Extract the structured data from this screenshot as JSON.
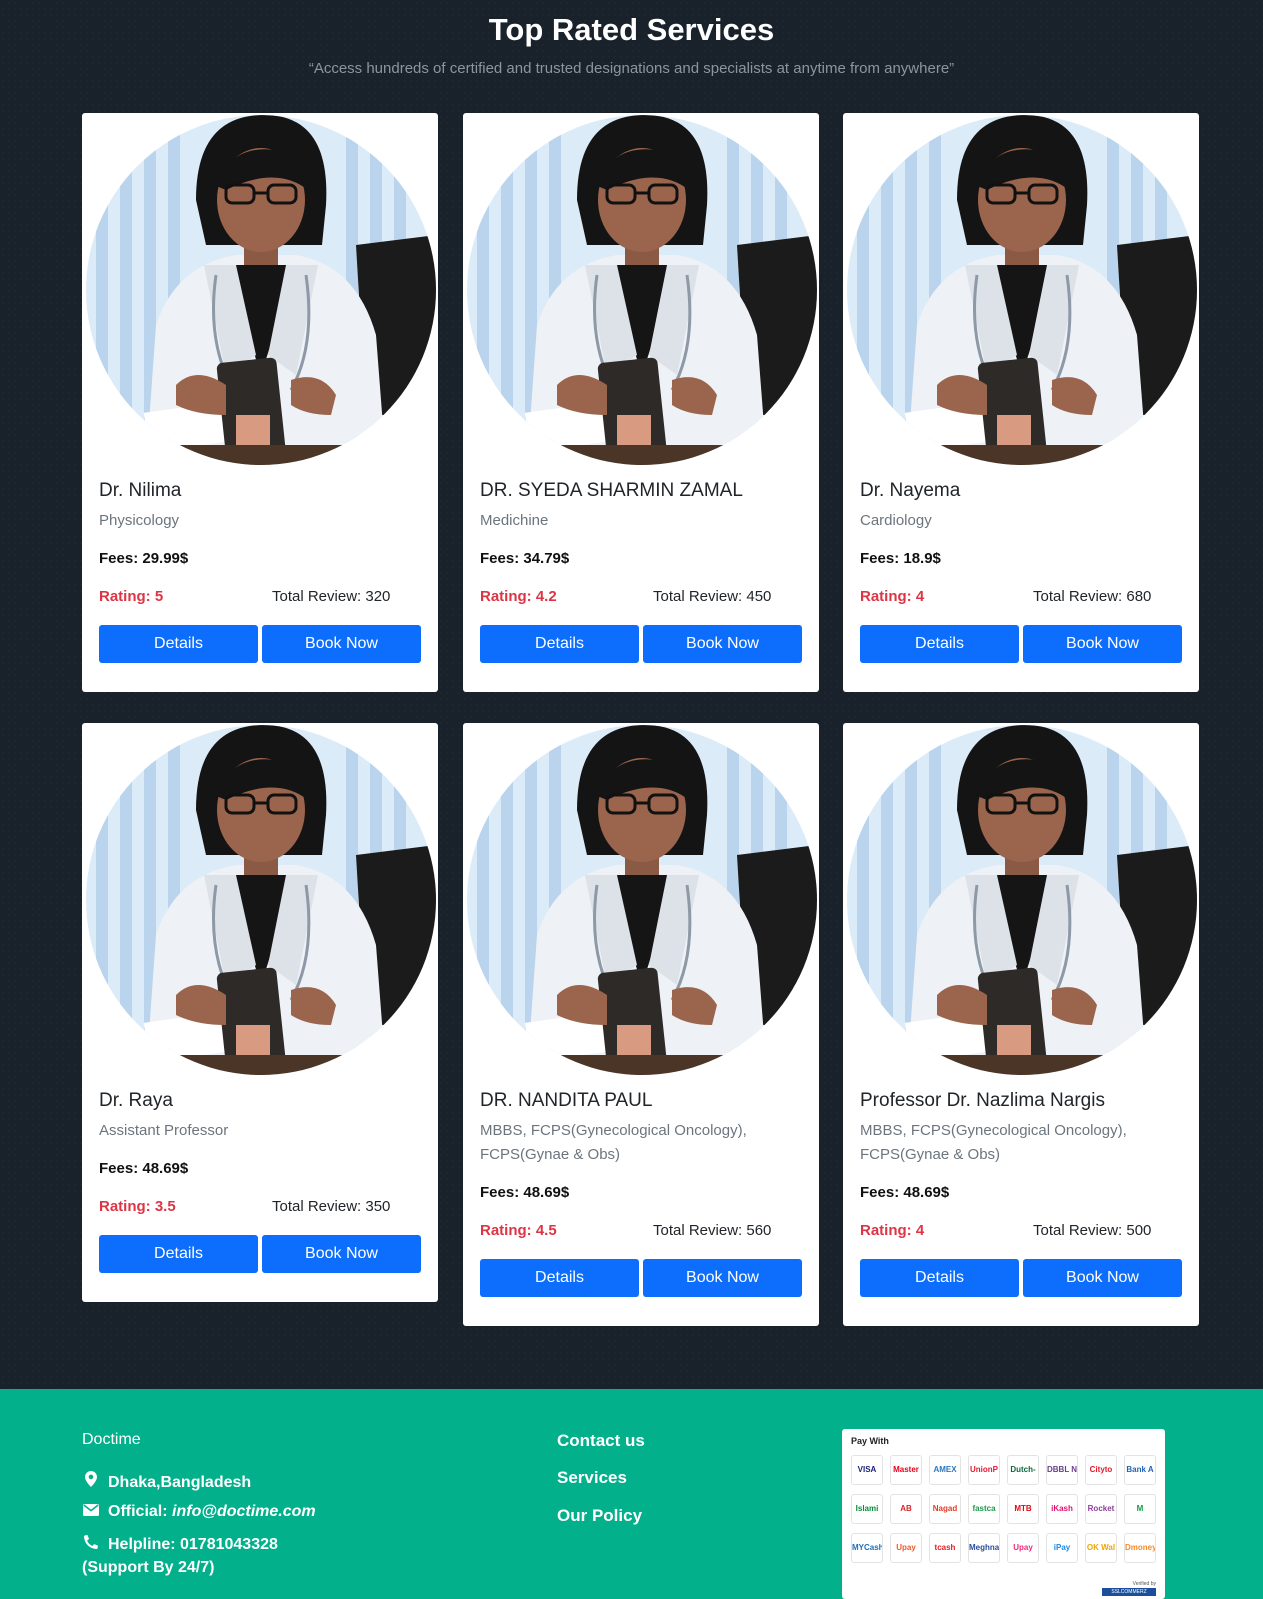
{
  "section": {
    "title": "Top Rated Services",
    "subtitle": "“Access hundreds of certified and trusted designations and specialists at anytime from anywhere”"
  },
  "doctors": [
    {
      "name": "Dr. Nilima",
      "specialty": "Physicology",
      "fees": "Fees: 29.99$",
      "rating": "Rating: 5",
      "reviews": "Total Review: 320",
      "details": "Details",
      "book": "Book Now"
    },
    {
      "name": "DR. SYEDA SHARMIN ZAMAL",
      "specialty": "Medichine",
      "fees": "Fees: 34.79$",
      "rating": "Rating: 4.2",
      "reviews": "Total Review: 450",
      "details": "Details",
      "book": "Book Now"
    },
    {
      "name": "Dr. Nayema",
      "specialty": "Cardiology",
      "fees": "Fees: 18.9$",
      "rating": "Rating: 4",
      "reviews": "Total Review: 680",
      "details": "Details",
      "book": "Book Now"
    },
    {
      "name": "Dr. Raya",
      "specialty": "Assistant Professor",
      "fees": "Fees: 48.69$",
      "rating": "Rating: 3.5",
      "reviews": "Total Review: 350",
      "details": "Details",
      "book": "Book Now"
    },
    {
      "name": "DR. NANDITA PAUL",
      "specialty": "MBBS, FCPS(Gynecological Oncology), FCPS(Gynae & Obs)",
      "fees": "Fees: 48.69$",
      "rating": "Rating: 4.5",
      "reviews": "Total Review: 560",
      "details": "Details",
      "book": "Book Now"
    },
    {
      "name": "Professor Dr. Nazlima Nargis",
      "specialty": "MBBS, FCPS(Gynecological Oncology), FCPS(Gynae & Obs)",
      "fees": "Fees: 48.69$",
      "rating": "Rating: 4",
      "reviews": "Total Review: 500",
      "details": "Details",
      "book": "Book Now"
    }
  ],
  "footer": {
    "brand": "Doctime",
    "location": "Dhaka,Bangladesh",
    "official_label": "Official: ",
    "email": "info@doctime.com",
    "helpline": "Helpline: 01781043328",
    "support": "(Support By 24/7)",
    "links": [
      "Contact us",
      "Services",
      "Our Policy"
    ],
    "pay_title": "Pay With",
    "payment_methods": [
      "VISA",
      "Mastercard",
      "AMEX",
      "UnionPay",
      "Dutch-Bangla",
      "DBBL Nexus",
      "Citytouch",
      "Bank Asia",
      "Islami Bank",
      "AB",
      "Nagad",
      "fastcash",
      "MTB",
      "iKash",
      "Rocket",
      "M",
      "MYCash",
      "Upay",
      "tcash",
      "Meghna",
      "Upay",
      "iPay",
      "OK Wallet",
      "Dmoney"
    ],
    "verified_by": "Verified by",
    "ssl": "SSLCOMMERZ"
  },
  "colors": {
    "background": "#19222b",
    "accent_button": "#0d6efd",
    "rating": "#dc3545",
    "footer": "#02b08c"
  }
}
